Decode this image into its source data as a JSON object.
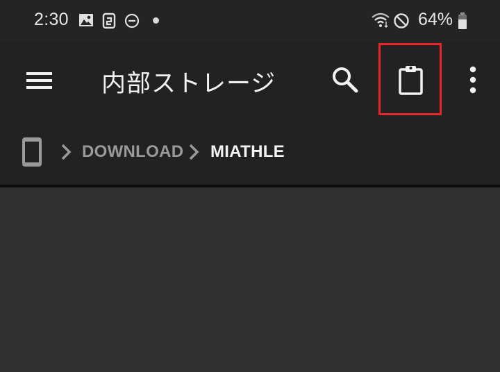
{
  "status_bar": {
    "time": "2:30",
    "battery_percent": "64%",
    "icons": [
      "image-icon",
      "screenshot-icon",
      "do-not-disturb-icon",
      "notification-dot-icon",
      "wifi-icon",
      "blocked-icon",
      "battery-icon"
    ]
  },
  "app_bar": {
    "title": "内部ストレージ",
    "menu_icon": "hamburger-menu-icon",
    "search_icon": "search-icon",
    "clipboard_icon": "clipboard-icon",
    "overflow_icon": "more-vert-icon"
  },
  "breadcrumb": {
    "root_icon": "phone-icon",
    "items": [
      "DOWNLOAD",
      "MIATHLE"
    ]
  },
  "colors": {
    "status_bar_bg": "#242424",
    "app_bar_bg": "#222222",
    "content_bg": "#303030",
    "highlight": "#e8262b",
    "crumb_inactive": "#9a9a9a",
    "crumb_active": "#f4f4f4"
  }
}
